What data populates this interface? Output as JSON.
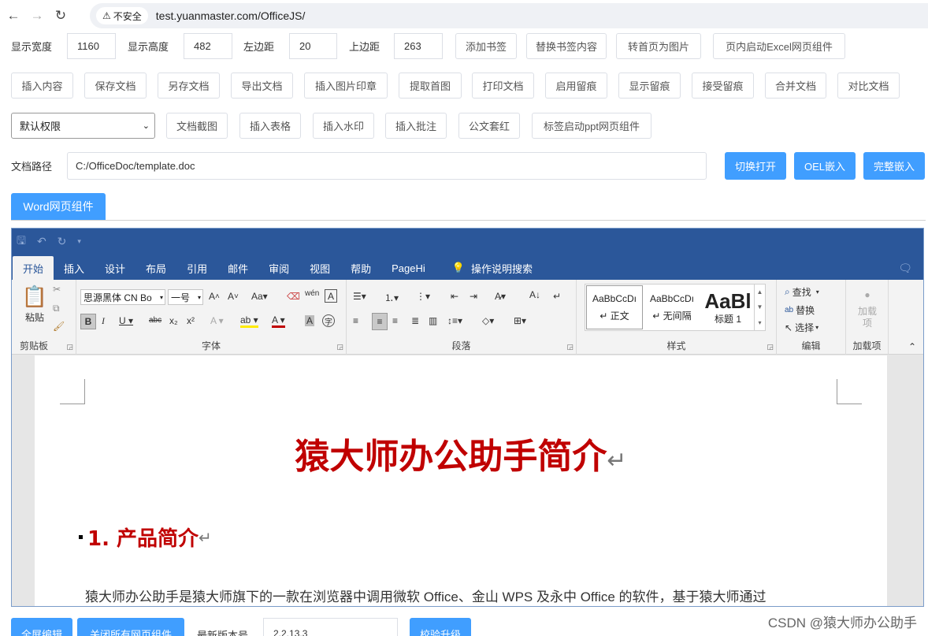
{
  "browser": {
    "back_icon": "arrow-left-icon",
    "forward_icon": "arrow-right-icon",
    "reload_icon": "reload-icon",
    "security_label": "不安全",
    "url": "test.yuanmaster.com/OfficeJS/"
  },
  "row1": {
    "width_label": "显示宽度",
    "width_value": "1160",
    "height_label": "显示高度",
    "height_value": "482",
    "left_label": "左边距",
    "left_value": "20",
    "top_label": "上边距",
    "top_value": "263",
    "btn_add_bookmark": "添加书签",
    "btn_replace_bookmark": "替换书签内容",
    "btn_first_page_image": "转首页为图片",
    "btn_excel": "页内启动Excel网页组件"
  },
  "row2": [
    "插入内容",
    "保存文档",
    "另存文档",
    "导出文档",
    "插入图片印章",
    "提取首图",
    "打印文档",
    "启用留痕",
    "显示留痕",
    "接受留痕",
    "合并文档",
    "对比文档"
  ],
  "row3": {
    "permission_select": "默认权限",
    "buttons": [
      "文档截图",
      "插入表格",
      "插入水印",
      "插入批注",
      "公文套红",
      "标签启动ppt网页组件"
    ]
  },
  "row4": {
    "path_label": "文档路径",
    "path_value": "C:/OfficeDoc/template.doc",
    "btn_switch_open": "切换打开",
    "btn_oel": "OEL嵌入",
    "btn_full_embed": "完整嵌入"
  },
  "word_tab": "Word网页组件",
  "word": {
    "tabs": [
      "开始",
      "插入",
      "设计",
      "布局",
      "引用",
      "邮件",
      "审阅",
      "视图",
      "帮助",
      "PageHi"
    ],
    "search_label": "操作说明搜索",
    "groups": {
      "clipboard": "剪贴板",
      "font": "字体",
      "paragraph": "段落",
      "styles": "样式",
      "editing": "编辑",
      "addins": "加载项"
    },
    "paste_label": "粘贴",
    "font_name": "思源黑体 CN Bo",
    "font_size": "一号",
    "styles": [
      {
        "preview": "AaBbCcDı",
        "name": "↵ 正文"
      },
      {
        "preview": "AaBbCcDı",
        "name": "↵ 无间隔"
      },
      {
        "preview": "AaBl",
        "name": "标题 1"
      }
    ],
    "edit_find": "查找",
    "edit_replace": "替换",
    "edit_select": "选择",
    "addins_label": "加载项",
    "doc_title": "猿大师办公助手简介",
    "heading1": "1. 产品简介",
    "para_mark": "↵",
    "body_text": "猿大师办公助手是猿大师旗下的一款在浏览器中调用微软 Office、金山 WPS 及永中 Office 的软件，基于猿大师通过"
  },
  "bottom": {
    "btn_fullscreen": "全屏编辑",
    "btn_close_all": "关闭所有网页组件",
    "version_label": "最新版本号",
    "version_value": "2.2.13.3",
    "btn_check_upgrade": "校验升级"
  },
  "watermark": "CSDN @猿大师办公助手"
}
